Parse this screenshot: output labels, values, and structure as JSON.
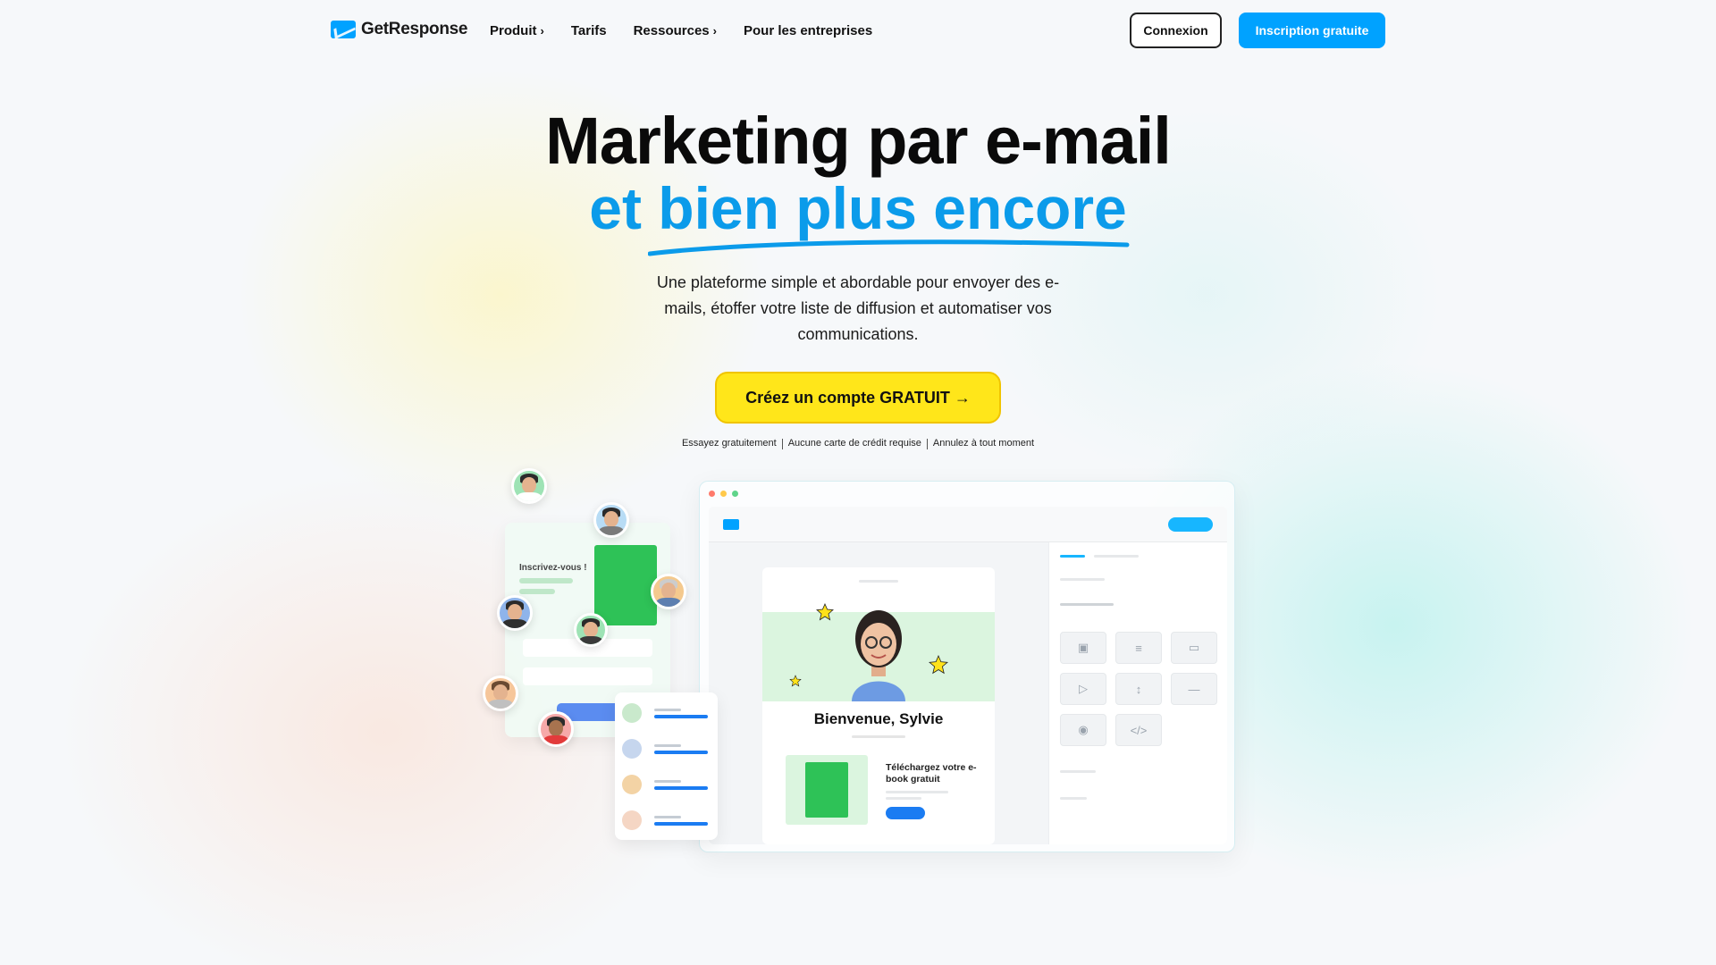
{
  "brand": {
    "name": "GetResponse",
    "accent": "#00a2ff",
    "cta_color": "#ffe61a"
  },
  "nav": {
    "items": [
      {
        "label": "Produit",
        "has_submenu": true
      },
      {
        "label": "Tarifs",
        "has_submenu": false
      },
      {
        "label": "Ressources",
        "has_submenu": true
      },
      {
        "label": "Pour les entreprises",
        "has_submenu": false
      }
    ],
    "submenu_glyph": "›",
    "login_label": "Connexion",
    "signup_label": "Inscription gratuite"
  },
  "hero": {
    "title_line1": "Marketing par e-mail",
    "title_line2": "et bien plus encore",
    "subtitle": "Une plateforme simple et abordable pour envoyer des e-mails, étoffer votre liste de diffusion et automatiser vos communications.",
    "cta_label": "Créez un compte GRATUIT →",
    "notes": [
      "Essayez gratuitement",
      "Aucune carte de crédit requise",
      "Annulez à tout moment"
    ]
  },
  "illustration": {
    "form_title": "Inscrivez-vous !",
    "email_card_title": "Bienvenue, Sylvie",
    "ebook_text": "Téléchargez votre e-book gratuit",
    "panel_icons": [
      "image-icon",
      "text-icon",
      "link-icon",
      "video-icon",
      "spacer-icon",
      "divider-icon",
      "social-icon",
      "code-icon"
    ]
  }
}
